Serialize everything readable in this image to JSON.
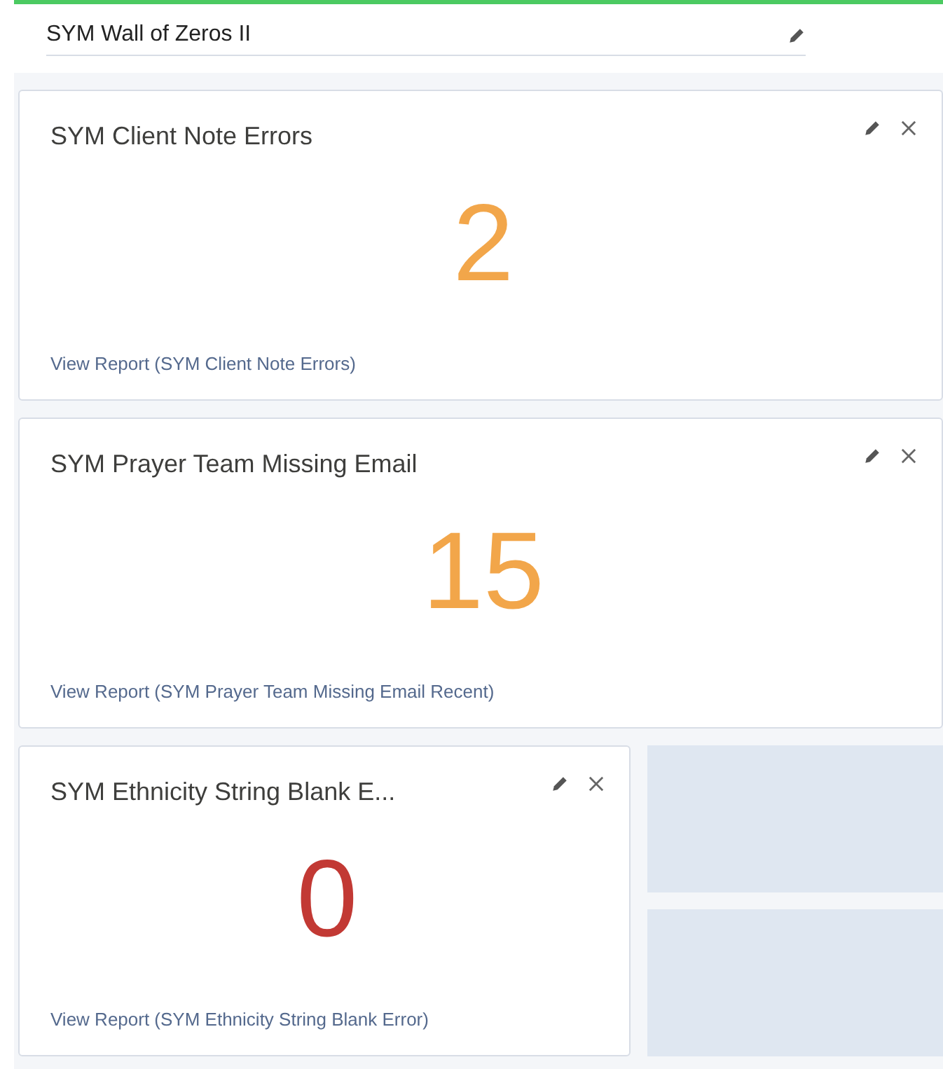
{
  "dashboard_title": "SYM Wall of Zeros II",
  "components": [
    {
      "title": "SYM Client Note Errors",
      "value": "2",
      "color": "#f2a64a",
      "link": "View Report (SYM Client Note Errors)",
      "wide": true
    },
    {
      "title": "SYM Prayer Team Missing Email",
      "value": "15",
      "color": "#f2a64a",
      "link": "View Report (SYM Prayer Team Missing Email Recent)",
      "wide": true
    },
    {
      "title": "SYM Ethnicity String Blank E...",
      "value": "0",
      "color": "#c23934",
      "link": "View Report (SYM Ethnicity String Blank Error)",
      "wide": false
    }
  ],
  "empty_slots": [
    {
      "kind": "slot"
    },
    {
      "kind": "slot"
    }
  ]
}
